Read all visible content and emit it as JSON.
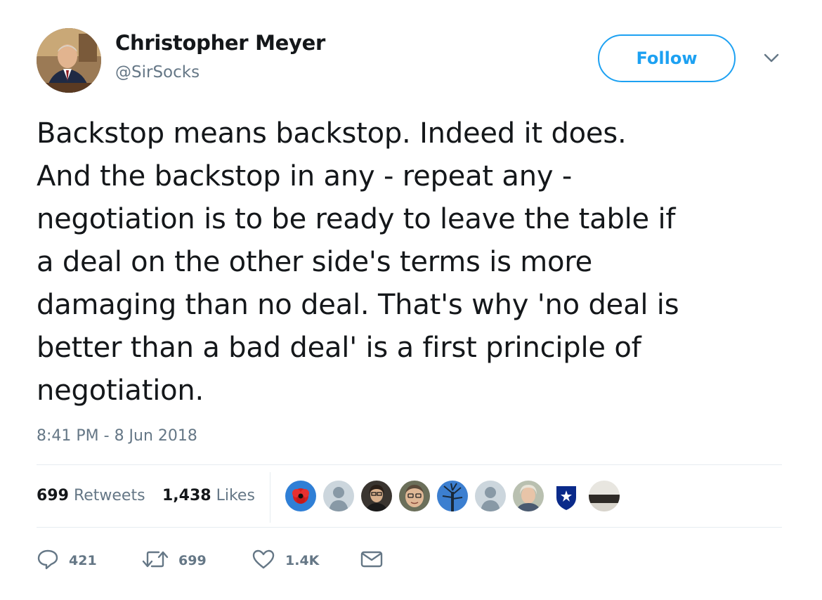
{
  "author": {
    "display_name": "Christopher Meyer",
    "handle": "@SirSocks"
  },
  "follow_label": "Follow",
  "tweet_text": "Backstop means backstop. Indeed it does.\nAnd the backstop in any - repeat any -\nnegotiation is to be ready to leave the table if\na deal on the other side's terms is more\ndamaging than no deal. That's why 'no deal is\nbetter than a bad deal' is a first principle of\nnegotiation.",
  "timestamp": "8:41 PM - 8 Jun 2018",
  "stats": {
    "retweets_count": "699",
    "retweets_label": "Retweets",
    "likes_count": "1,438",
    "likes_label": "Likes"
  },
  "liker_avatars": [
    "poppy",
    "default",
    "person",
    "person",
    "tree",
    "default",
    "person",
    "crest",
    "landscape"
  ],
  "actions": {
    "reply_count": "421",
    "retweet_count": "699",
    "like_count": "1.4K"
  },
  "colors": {
    "brand_blue": "#1da1f2",
    "secondary_text": "#657786",
    "primary_text": "#14171a",
    "divider": "#e6ecf0"
  }
}
